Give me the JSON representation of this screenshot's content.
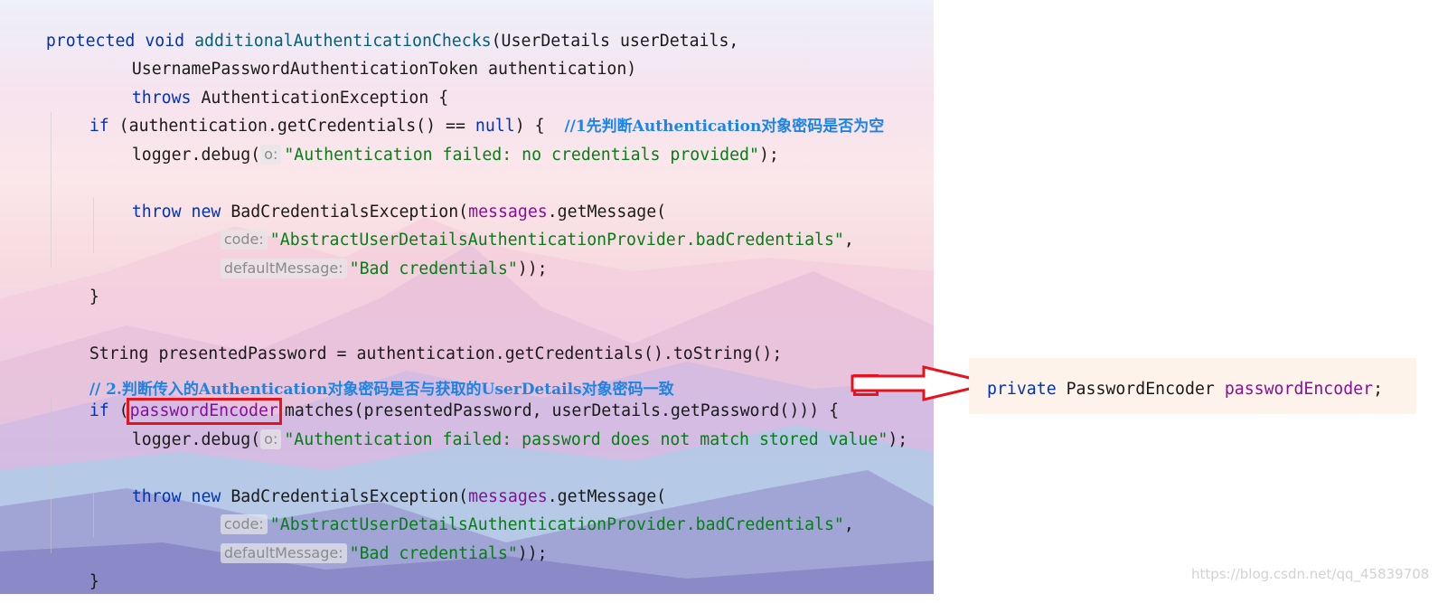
{
  "code": {
    "l1": {
      "kw1": "protected",
      "kw2": "void",
      "fn": "additionalAuthenticationChecks",
      "rest": "(UserDetails userDetails,"
    },
    "l2": {
      "text": "UsernamePasswordAuthenticationToken authentication)"
    },
    "l3": {
      "kw": "throws",
      "rest": " AuthenticationException {"
    },
    "l4": {
      "kw": "if",
      "mid": " (authentication.getCredentials() == ",
      "kw2": "null",
      "rest": ") {  ",
      "comment": "//1先判断Authentication对象密码是否为空"
    },
    "l5": {
      "pre": "logger.debug(",
      "hint": "o:",
      "str": "\"Authentication failed: no credentials provided\"",
      "post": ");"
    },
    "l7": {
      "kw1": "throw",
      "kw2": "new",
      "mid": " BadCredentialsException(",
      "fld": "messages",
      "post": ".getMessage("
    },
    "l8": {
      "hint": "code:",
      "str": "\"AbstractUserDetailsAuthenticationProvider.badCredentials\"",
      "post": ","
    },
    "l9": {
      "hint": "defaultMessage:",
      "str": "\"Bad credentials\"",
      "post": "));"
    },
    "l10": {
      "text": "}"
    },
    "l12": {
      "text": "String presentedPassword = authentication.getCredentials().toString();"
    },
    "l13": {
      "comment": "// 2.判断传入的Authentication对象密码是否与获取的UserDetails对象密码一致"
    },
    "l14": {
      "kw": "if",
      "pre": " (",
      "boxed": "passwordEncoder",
      "post": "matches(presentedPassword, userDetails.getPassword())) {"
    },
    "l15": {
      "pre": "logger.debug(",
      "hint": "o:",
      "str": "\"Authentication failed: password does not match stored value\"",
      "post": ");"
    },
    "l17": {
      "kw1": "throw",
      "kw2": "new",
      "mid": " BadCredentialsException(",
      "fld": "messages",
      "post": ".getMessage("
    },
    "l18": {
      "hint": "code:",
      "str": "\"AbstractUserDetailsAuthenticationProvider.badCredentials\"",
      "post": ","
    },
    "l19": {
      "hint": "defaultMessage:",
      "str": "\"Bad credentials\"",
      "post": "));"
    },
    "l20": {
      "text": "}"
    },
    "l21": {
      "text": "}"
    }
  },
  "field_declaration": {
    "kw": "private",
    "type": " PasswordEncoder ",
    "name": "passwordEncoder",
    "end": ";"
  },
  "watermark": "https://blog.csdn.net/qq_45839708",
  "colors": {
    "keyword": "#0033b3",
    "method": "#00627a",
    "string": "#067d17",
    "field": "#871094",
    "comment": "#1d84e4",
    "highlight_box": "#e5131e"
  }
}
